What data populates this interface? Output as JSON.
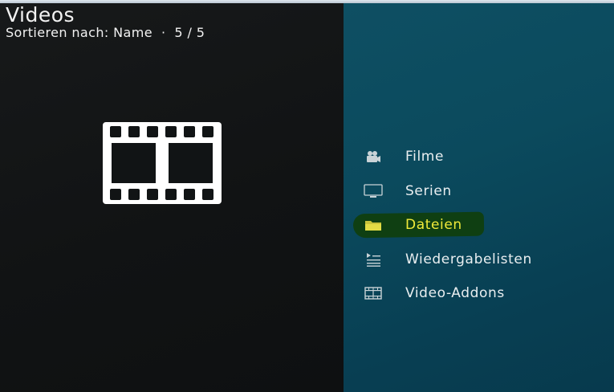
{
  "header": {
    "title": "Videos",
    "sort_label": "Sortieren nach: Name",
    "separator": "·",
    "count": "5 / 5"
  },
  "menu": {
    "items": [
      {
        "label": "Filme",
        "icon": "film-camera-icon",
        "focused": false
      },
      {
        "label": "Serien",
        "icon": "tv-icon",
        "focused": false
      },
      {
        "label": "Dateien",
        "icon": "folder-icon",
        "focused": true
      },
      {
        "label": "Wiedergabelisten",
        "icon": "playlist-icon",
        "focused": false
      },
      {
        "label": "Video-Addons",
        "icon": "addon-filmstrip-icon",
        "focused": false
      }
    ]
  },
  "colors": {
    "left_background": "#111415",
    "right_background": "#0b4a5d",
    "focus_text": "#f0ea3a",
    "text": "#e9eef0",
    "focus_marker": "#0f3f12"
  }
}
